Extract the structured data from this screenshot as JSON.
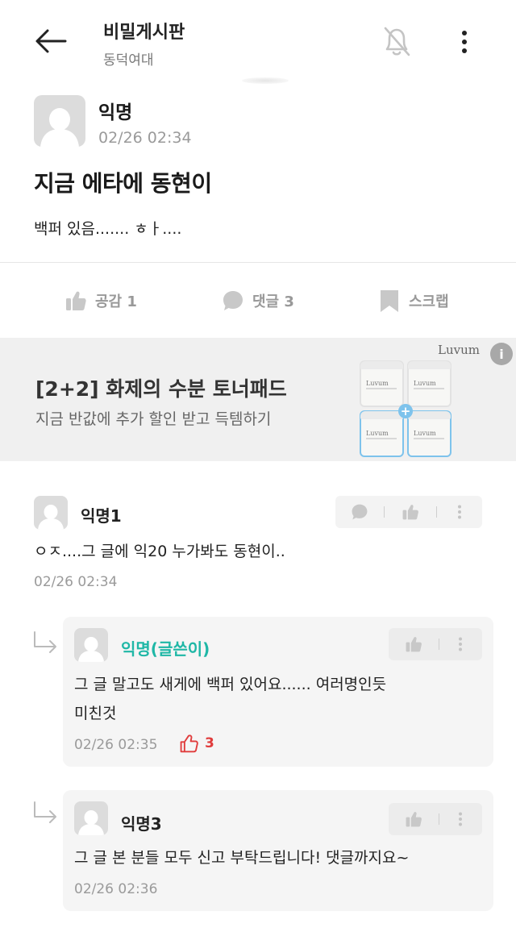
{
  "header": {
    "title": "비밀게시판",
    "subtitle": "동덕여대",
    "back_icon": "back-arrow-icon",
    "notify_icon": "bell-off-icon",
    "menu_icon": "more-vertical-icon"
  },
  "post": {
    "author": "익명",
    "time": "02/26 02:34",
    "title": "지금 에타에 동현이",
    "body": "백퍼 있음....... ㅎㅏ....",
    "actions": [
      {
        "icon": "thumbs-up-icon",
        "label": "공감 1"
      },
      {
        "icon": "comment-bubble-icon",
        "label": "댓글 3"
      },
      {
        "icon": "bookmark-icon",
        "label": "스크랩"
      }
    ]
  },
  "ad": {
    "title": "[2+2] 화제의 수분 토너패드",
    "subtitle": "지금 반값에 추가 할인 받고 득템하기",
    "brand": "Luvum",
    "info_icon": "info-icon",
    "product_text": "Luvum"
  },
  "comments": [
    {
      "author": "익명1",
      "text": "ㅇㅈ....그 글에 익20 누가봐도 동현이..",
      "time": "02/26 02:34"
    }
  ],
  "replies": [
    {
      "author": "익명(글쓴이)",
      "text_line1": "그 글 말고도 새게에 백퍼 있어요...... 여러명인듯",
      "text_line2": "미친것",
      "time": "02/26 02:35",
      "likes": "3"
    },
    {
      "author": "익명3",
      "text": "그 글 본 분들 모두 신고 부탁드립니다! 댓글까지요~",
      "time": "02/26 02:36"
    }
  ],
  "colors": {
    "op_name": "#1fb7a6",
    "like_red": "#e03c3c",
    "ad_background": "#f0f0f0",
    "muted_text": "#9a9a9a"
  }
}
